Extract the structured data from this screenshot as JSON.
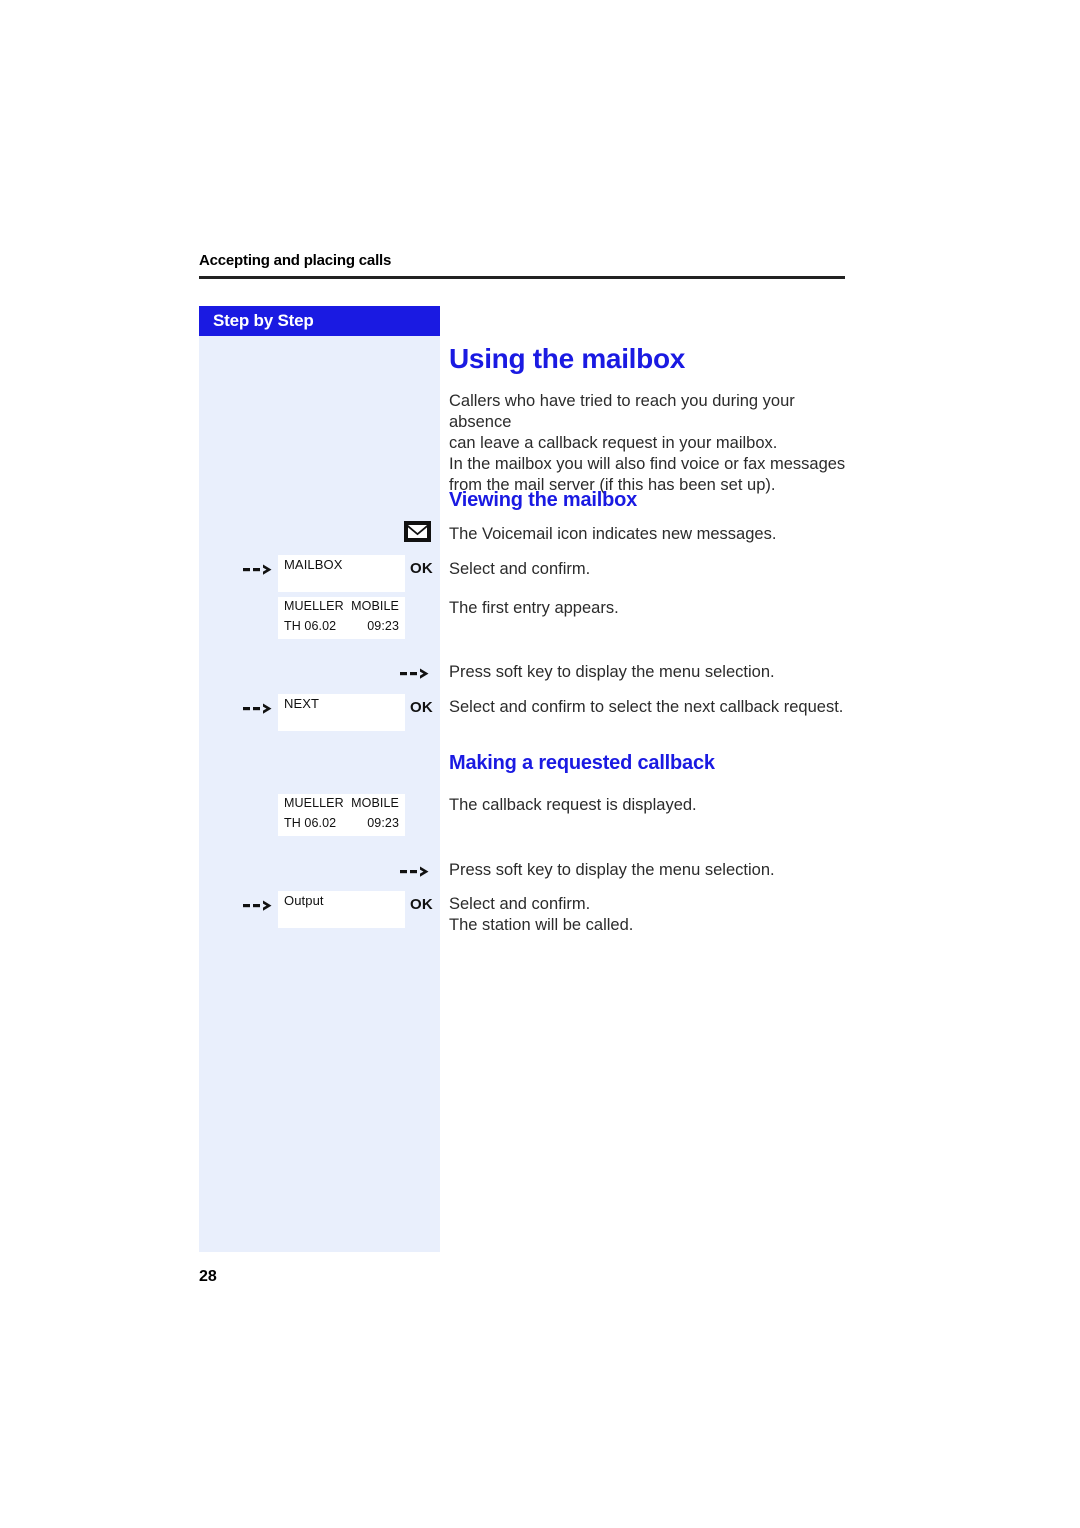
{
  "header": {
    "running_title": "Accepting and placing calls"
  },
  "sidebar": {
    "title": "Step by Step"
  },
  "content": {
    "h1_using_mailbox": "Using the mailbox",
    "intro_line1": "Callers who have tried to reach you during your absence",
    "intro_line2": "can leave a callback request in your mailbox.",
    "intro_line3": "In the mailbox you will also find voice or fax messages",
    "intro_line4": "from the mail server (if this has been set up).",
    "h2_viewing_mailbox": "Viewing the mailbox",
    "h2_making_callback": "Making a requested callback",
    "note_voicemail_icon": "The Voicemail icon indicates new messages.",
    "note_select_confirm": "Select and confirm.",
    "note_first_entry": "The first entry appears.",
    "note_press_softkey_1": "Press soft key to display the menu selection.",
    "note_select_next": "Select and confirm to select the next callback request.",
    "note_callback_displayed": "The callback request is displayed.",
    "note_press_softkey_2": "Press soft key to display the menu selection.",
    "note_select_confirm_2": "Select and confirm.",
    "note_station_called": "The station will be called."
  },
  "softkeys": {
    "mailbox": {
      "label": "MAILBOX",
      "confirm": "OK"
    },
    "next": {
      "label": "NEXT",
      "confirm": "OK"
    },
    "output": {
      "label": "Output",
      "confirm": "OK"
    }
  },
  "display_entries": [
    {
      "name": "MUELLER",
      "type": "MOBILE",
      "date": "TH 06.02",
      "time": "09:23"
    },
    {
      "name": "MUELLER",
      "type": "MOBILE",
      "date": "TH 06.02",
      "time": "09:23"
    }
  ],
  "footer": {
    "page_number": "28"
  },
  "colors": {
    "accent_blue": "#1a1ae2",
    "panel_bg": "#e9effc",
    "text": "#2b2b2b"
  }
}
